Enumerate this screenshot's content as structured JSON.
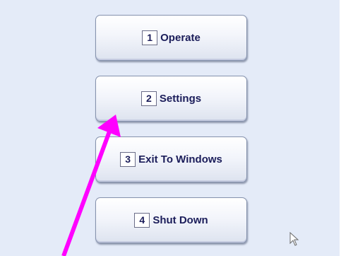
{
  "menu": {
    "items": [
      {
        "key": "1",
        "label": "Operate"
      },
      {
        "key": "2",
        "label": "Settings"
      },
      {
        "key": "3",
        "label": "Exit To Windows"
      },
      {
        "key": "4",
        "label": "Shut Down"
      }
    ]
  },
  "annotation": {
    "arrow_color": "#ff00ff",
    "points_to": "settings-button"
  },
  "cursor": {
    "icon": "mouse-pointer-icon"
  },
  "colors": {
    "background": "#e4ebf8",
    "button_text": "#1b1d5a"
  }
}
